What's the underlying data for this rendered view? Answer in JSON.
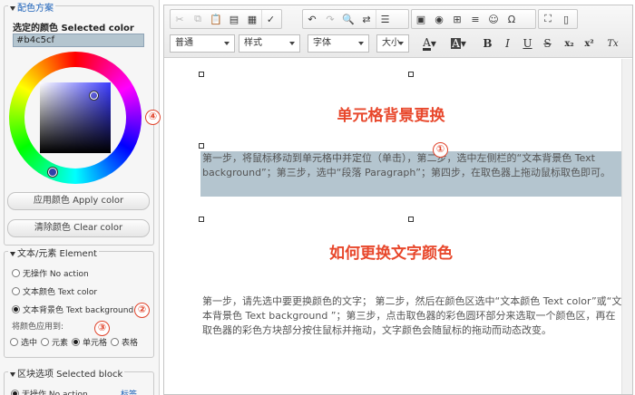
{
  "left": {
    "scheme_legend": "配色方案",
    "selected_label": "选定的颜色 Selected color",
    "hex_value": "#b4c5cf",
    "apply_btn": "应用颜色 Apply color",
    "clear_btn": "清除颜色 Clear color",
    "element_legend": "文本/元素 Element",
    "radios": [
      {
        "label": "无操作 No action",
        "checked": false
      },
      {
        "label": "文本颜色 Text color",
        "checked": false
      },
      {
        "label": "文本背景色 Text background",
        "checked": true
      }
    ],
    "apply_to_label": "将颜色应用到:",
    "apply_options": [
      "选中",
      "元素",
      "单元格",
      "表格"
    ],
    "apply_selected": "单元格",
    "block_legend": "区块选项 Selected block",
    "block_first_option": "无操作 No action",
    "block_link": "标签"
  },
  "toolbar": {
    "combos": [
      "普通",
      "样式",
      "字体",
      "大小"
    ],
    "format_buttons": [
      "B",
      "I",
      "U",
      "S",
      "x₂",
      "x²",
      "Tx"
    ]
  },
  "doc": {
    "heading1": "单元格背景更换",
    "para1": "第一步，将鼠标移动到单元格中并定位（单击），第二步，选中左侧栏的“文本背景色 Text background”；第三步，选中“段落 Paragraph”；第四步，在取色器上拖动鼠标取色即可。",
    "heading2": "如何更换文字颜色",
    "para2": "第一步，请先选中要更换颜色的文字； 第二步，然后在颜色区选中“文本颜色 Text color”或“文本背景色 Text background ”；第三步，点击取色器的彩色圆环部分来选取一个颜色区，再在取色器的彩色方块部分按住鼠标并拖动，文字颜色会随鼠标的拖动而动态改变。"
  },
  "badges": [
    "①",
    "②",
    "③",
    "④"
  ],
  "colors": {
    "accent": "#e8472b",
    "cell_bg": "#b4c5cf",
    "link": "#1a60b8"
  }
}
